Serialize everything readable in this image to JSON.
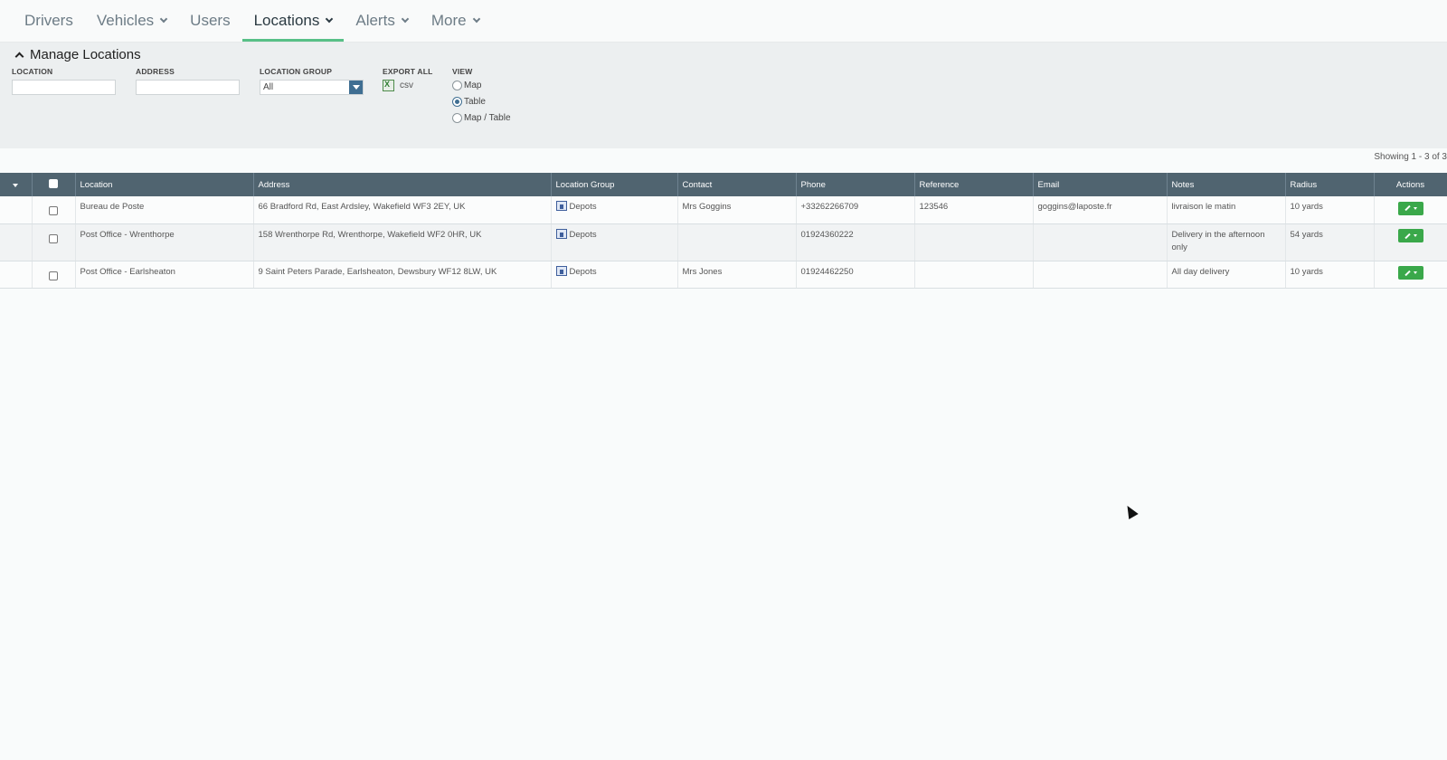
{
  "nav": {
    "items": [
      {
        "label": "Drivers",
        "dropdown": false,
        "active": false
      },
      {
        "label": "Vehicles",
        "dropdown": true,
        "active": false
      },
      {
        "label": "Users",
        "dropdown": false,
        "active": false
      },
      {
        "label": "Locations",
        "dropdown": true,
        "active": true
      },
      {
        "label": "Alerts",
        "dropdown": true,
        "active": false
      },
      {
        "label": "More",
        "dropdown": true,
        "active": false
      }
    ]
  },
  "panel": {
    "title": "Manage Locations",
    "location_label": "LOCATION",
    "location_value": "",
    "address_label": "ADDRESS",
    "address_value": "",
    "group_label": "LOCATION GROUP",
    "group_value": "All",
    "export_label": "EXPORT ALL",
    "export_csv": "csv",
    "view_label": "VIEW",
    "view_options": [
      "Map",
      "Table",
      "Map / Table"
    ],
    "view_selected": "Table"
  },
  "showing": "Showing 1 - 3 of 3",
  "table": {
    "headers": [
      "Location",
      "Address",
      "Location Group",
      "Contact",
      "Phone",
      "Reference",
      "Email",
      "Notes",
      "Radius",
      "Actions"
    ],
    "rows": [
      {
        "location": "Bureau de Poste",
        "address": "66 Bradford Rd, East Ardsley, Wakefield WF3 2EY, UK",
        "group": "Depots",
        "contact": "Mrs Goggins",
        "phone": "+33262266709",
        "reference": "123546",
        "email": "goggins@laposte.fr",
        "notes": "livraison le matin",
        "radius": "10 yards"
      },
      {
        "location": "Post Office - Wrenthorpe",
        "address": "158 Wrenthorpe Rd, Wrenthorpe, Wakefield WF2 0HR, UK",
        "group": "Depots",
        "contact": "",
        "phone": "01924360222",
        "reference": "",
        "email": "",
        "notes": "Delivery in the afternoon only",
        "radius": "54 yards"
      },
      {
        "location": "Post Office - Earlsheaton",
        "address": "9 Saint Peters Parade, Earlsheaton, Dewsbury WF12 8LW, UK",
        "group": "Depots",
        "contact": "Mrs Jones",
        "phone": "01924462250",
        "reference": "",
        "email": "",
        "notes": "All day delivery",
        "radius": "10 yards"
      }
    ]
  },
  "colors": {
    "header_bg": "#506470",
    "accent_green": "#58c087",
    "action_button": "#3aa84a",
    "panel_bg": "#eceff0"
  }
}
